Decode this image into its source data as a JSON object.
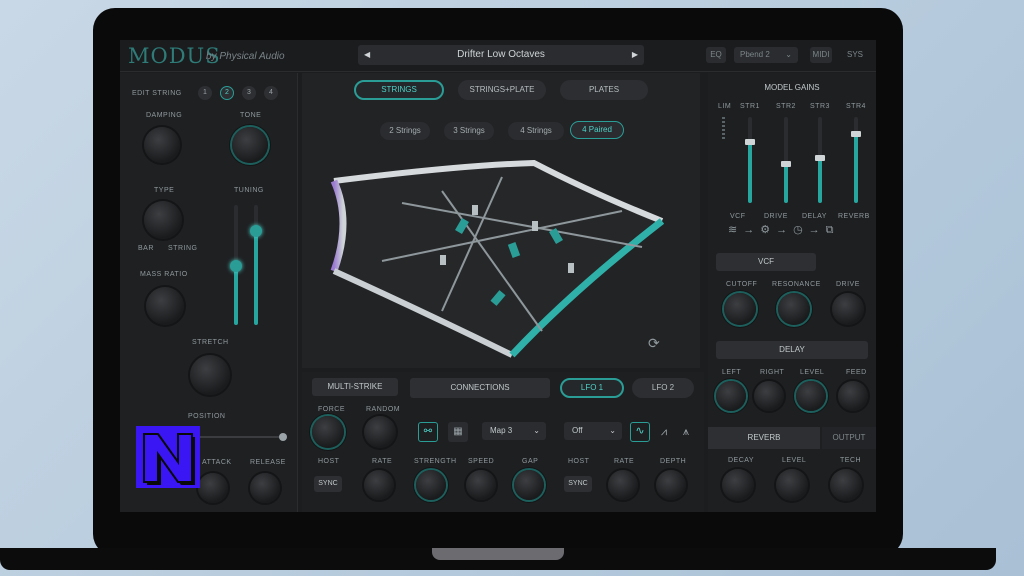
{
  "plugin": {
    "brand": "MODUS",
    "brand_sub": "by Physical Audio",
    "preset": "Drifter Low Octaves",
    "prev_icon": "triangle-left-icon",
    "next_icon": "triangle-right-icon"
  },
  "topbar": {
    "eq": "EQ",
    "pbend": "Pbend 2",
    "small1": "MIDI",
    "small2": "SYS"
  },
  "left": {
    "edit_strings": "EDIT STRING",
    "string_nums": [
      "1",
      "2",
      "3",
      "4"
    ],
    "damping": "DAMPING",
    "tone": "TONE",
    "type": "TYPE",
    "type_left": "BAR",
    "type_right": "STRING",
    "tuning": "TUNING",
    "mass_ratio": "MASS RATIO",
    "stretch": "STRETCH",
    "position": "POSITION",
    "attack": "ATTACK",
    "release": "RELEASE"
  },
  "center": {
    "tabs": [
      "STRINGS",
      "STRINGS+PLATE",
      "PLATES"
    ],
    "chips": [
      "2 Strings",
      "3 Strings",
      "4 Strings",
      "4 Paired"
    ]
  },
  "bottom": {
    "multi_strike": "MULTI-STRIKE",
    "connections": "CONNECTIONS",
    "lfo1": "LFO 1",
    "lfo2": "LFO 2",
    "force": "FORCE",
    "random": "RANDOM",
    "map": "Map 3",
    "off": "Off",
    "host": "HOST",
    "rate": "RATE",
    "strength": "STRENGTH",
    "speed": "SPEED",
    "gap": "GAP",
    "host2": "HOST",
    "rate2": "RATE",
    "depth": "DEPTH",
    "sync": "SYNC"
  },
  "right": {
    "model_gains": "MODEL GAINS",
    "fader_labels": [
      "LIM",
      "STR1",
      "STR2",
      "STR3",
      "STR4"
    ],
    "fx_labels": [
      "VCF",
      "DRIVE",
      "DELAY",
      "REVERB"
    ],
    "vcf": "VCF",
    "cutoff": "CUTOFF",
    "resonance": "RESONANCE",
    "drive": "DRIVE",
    "delay": "DELAY",
    "left": "LEFT",
    "right": "RIGHT",
    "level": "LEVEL",
    "feed": "FEED",
    "reverb": "REVERB",
    "output": "OUTPUT",
    "decay": "DECAY",
    "level2": "LEVEL",
    "tech": "TECH"
  },
  "colors": {
    "accent": "#2a9d97",
    "accent_light": "#4fd1c9",
    "brand_block": "#3a16f5"
  }
}
